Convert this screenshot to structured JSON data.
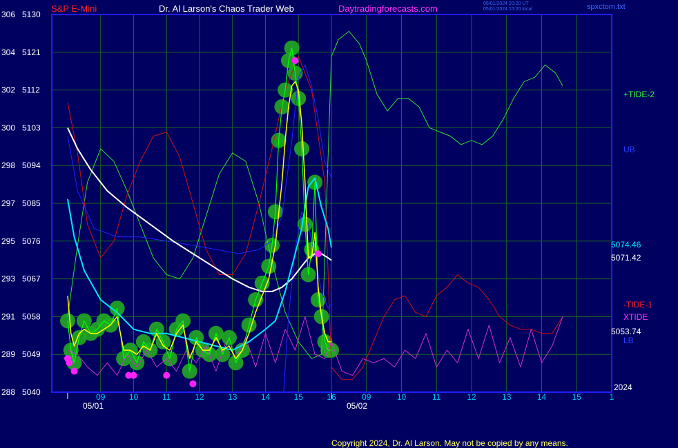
{
  "header": {
    "symbol": "S&P E-Mini",
    "title": "Dr. Al Larson's Chaos Trader Web",
    "site": "Daytradingforecasts.com",
    "stamp_ut": "05/01/2024 20:20 UT",
    "stamp_local": "05/01/2024 15:20 local",
    "file": "spxctom.txt"
  },
  "footer": {
    "copyright": "Copyright 2024, Dr. Al Larson. May not be copied by any means."
  },
  "labels": {
    "tide2": "+TIDE-2",
    "ub": "UB",
    "cyan_value": "5074.46",
    "white_value": "5071.42",
    "tide1": "-TIDE-1",
    "xtide": "XTIDE",
    "yellow_value": "5053.74",
    "lb": "LB",
    "year": "2024"
  },
  "colors": {
    "background": "#000060",
    "frame": "#1e1eff",
    "grid": "#1a6a1a",
    "price": "#00ff00",
    "smooth": "#ffff00",
    "cyan": "#00e5ff",
    "white": "#ffffff",
    "tide2": "#33dd33",
    "tide1": "#cc1111",
    "xtide": "#cc33cc",
    "bands": "#2222ff",
    "halo": "#22aa22",
    "marker": "#ff22ff"
  },
  "chart_data": {
    "type": "line",
    "y_left_labels": [
      "306",
      "304",
      "302",
      "300",
      "298",
      "297",
      "295",
      "293",
      "291",
      "289",
      "288"
    ],
    "y_right_labels": [
      "5130",
      "5121",
      "5112",
      "5103",
      "5094",
      "5085",
      "5076",
      "5067",
      "5058",
      "5049",
      "5040"
    ],
    "x_labels": [
      "09",
      "10",
      "11",
      "12",
      "13",
      "14",
      "15",
      "16",
      "09",
      "10",
      "11",
      "12",
      "13",
      "14",
      "15",
      "1"
    ],
    "date_labels": [
      "05/01",
      "05/02"
    ],
    "ylim": [
      5040,
      5130
    ],
    "grid": true,
    "series": [
      {
        "role": "price",
        "x": [
          8.0,
          8.1,
          8.2,
          8.35,
          8.5,
          8.7,
          8.9,
          9.1,
          9.3,
          9.5,
          9.7,
          9.9,
          10.1,
          10.3,
          10.5,
          10.7,
          10.9,
          11.1,
          11.3,
          11.5,
          11.7,
          11.9,
          12.1,
          12.3,
          12.5,
          12.7,
          12.9,
          13.1,
          13.3,
          13.5,
          13.7,
          13.9,
          14.1,
          14.2,
          14.3,
          14.4,
          14.5,
          14.6,
          14.7,
          14.8,
          14.9,
          15.0,
          15.1,
          15.2,
          15.3,
          15.4,
          15.5,
          15.6,
          15.7,
          15.8,
          15.9,
          16.0
        ],
        "values": [
          5057,
          5050,
          5047,
          5053,
          5057,
          5054,
          5055,
          5057,
          5056,
          5060,
          5048,
          5050,
          5047,
          5052,
          5050,
          5055,
          5052,
          5048,
          5055,
          5057,
          5045,
          5053,
          5050,
          5049,
          5054,
          5049,
          5053,
          5047,
          5050,
          5056,
          5062,
          5066,
          5070,
          5075,
          5083,
          5100,
          5108,
          5112,
          5119,
          5122,
          5116,
          5110,
          5098,
          5080,
          5068,
          5074,
          5090,
          5062,
          5058,
          5052,
          5050,
          5050
        ]
      },
      {
        "role": "smooth",
        "x": [
          8.0,
          8.1,
          8.2,
          8.35,
          8.5,
          8.7,
          8.9,
          9.1,
          9.3,
          9.5,
          9.7,
          9.9,
          10.1,
          10.3,
          10.5,
          10.7,
          10.9,
          11.1,
          11.3,
          11.5,
          11.7,
          11.9,
          12.1,
          12.3,
          12.5,
          12.7,
          12.9,
          13.1,
          13.3,
          13.5,
          13.7,
          13.9,
          14.1,
          14.3,
          14.5,
          14.6,
          14.7,
          14.8,
          14.9,
          15.0,
          15.1,
          15.2,
          15.3,
          15.4,
          15.5,
          15.6,
          15.7,
          15.8,
          15.9,
          16.0
        ],
        "values": [
          5063,
          5054,
          5051,
          5054,
          5055,
          5054,
          5054,
          5055,
          5056,
          5058,
          5050,
          5050,
          5049,
          5051,
          5050,
          5054,
          5051,
          5050,
          5054,
          5056,
          5048,
          5052,
          5050,
          5050,
          5053,
          5050,
          5051,
          5048,
          5050,
          5054,
          5059,
          5063,
          5067,
          5075,
          5090,
          5100,
          5108,
          5113,
          5114,
          5112,
          5104,
          5090,
          5072,
          5072,
          5078,
          5065,
          5058,
          5054,
          5052,
          5052
        ]
      },
      {
        "role": "cyan",
        "x": [
          8.0,
          8.2,
          8.5,
          9.0,
          9.5,
          10.0,
          10.5,
          11.0,
          11.5,
          12.0,
          12.5,
          13.0,
          13.5,
          14.0,
          14.3,
          14.6,
          14.9,
          15.1,
          15.3,
          15.5,
          15.7,
          15.9,
          16.0
        ],
        "values": [
          5086,
          5077,
          5069,
          5062,
          5059,
          5055,
          5054,
          5054,
          5053,
          5052,
          5051,
          5050,
          5052,
          5055,
          5057,
          5064,
          5073,
          5079,
          5089,
          5091,
          5084,
          5079,
          5074.46
        ]
      },
      {
        "role": "white",
        "x": [
          8.0,
          8.3,
          8.7,
          9.2,
          9.8,
          10.5,
          11.2,
          11.8,
          12.4,
          13.0,
          13.5,
          13.9,
          14.2,
          14.5,
          14.8,
          15.1,
          15.3,
          15.5,
          15.7,
          15.9,
          16.0
        ],
        "values": [
          5103,
          5098,
          5093,
          5088,
          5084,
          5080,
          5076,
          5073,
          5070,
          5067,
          5065,
          5064,
          5064,
          5065,
          5067,
          5070,
          5072,
          5073,
          5073,
          5072,
          5071.42
        ]
      },
      {
        "role": "tide2",
        "x": [
          8.0,
          8.3,
          8.6,
          9.0,
          9.4,
          9.8,
          10.2,
          10.6,
          11.0,
          11.4,
          11.8,
          12.2,
          12.6,
          13.0,
          13.4,
          13.8,
          14.2,
          14.6,
          15.0,
          15.4,
          15.7,
          16.0,
          16.2,
          16.5,
          16.8,
          17.0,
          17.3,
          17.6,
          17.9,
          18.2,
          18.5,
          18.8,
          19.1,
          19.4,
          19.7,
          20.0,
          20.3,
          20.6,
          20.9,
          21.2,
          21.5,
          21.8,
          22.1,
          22.4,
          22.6
        ],
        "values": [
          5058,
          5075,
          5090,
          5098,
          5095,
          5088,
          5080,
          5072,
          5068,
          5067,
          5072,
          5082,
          5092,
          5097,
          5095,
          5085,
          5071,
          5059,
          5052,
          5048,
          5049,
          5120,
          5124,
          5126,
          5123,
          5119,
          5111,
          5107,
          5110,
          5110,
          5108,
          5103,
          5102,
          5101,
          5099,
          5100,
          5099,
          5101,
          5105,
          5110,
          5114,
          5115,
          5118,
          5116,
          5113
        ]
      },
      {
        "role": "tide1",
        "x": [
          8.0,
          8.3,
          8.6,
          9.0,
          9.4,
          9.8,
          10.2,
          10.6,
          11.0,
          11.4,
          11.8,
          12.2,
          12.6,
          13.0,
          13.4,
          13.8,
          14.2,
          14.6,
          15.0,
          15.4,
          15.8,
          16.0,
          16.3,
          16.6,
          16.9,
          17.2,
          17.5,
          17.8,
          18.1,
          18.4,
          18.7,
          19.0,
          19.3,
          19.6,
          19.9,
          20.2,
          20.5,
          20.8,
          21.1,
          21.4,
          21.7,
          22.0,
          22.3,
          22.6
        ],
        "values": [
          5109,
          5097,
          5080,
          5072,
          5076,
          5087,
          5095,
          5101,
          5102,
          5096,
          5085,
          5074,
          5068,
          5068,
          5073,
          5085,
          5098,
          5112,
          5120,
          5112,
          5090,
          5046,
          5043,
          5043,
          5046,
          5052,
          5058,
          5062,
          5063,
          5059,
          5058,
          5063,
          5065,
          5068,
          5066,
          5065,
          5062,
          5058,
          5056,
          5055,
          5055,
          5054,
          5054,
          5058
        ]
      },
      {
        "role": "xtide",
        "x": [
          8.0,
          8.3,
          8.6,
          8.9,
          9.2,
          9.5,
          9.8,
          10.1,
          10.4,
          10.7,
          11.0,
          11.3,
          11.6,
          11.9,
          12.2,
          12.5,
          12.8,
          13.1,
          13.4,
          13.7,
          14.0,
          14.3,
          14.6,
          14.9,
          15.2,
          15.5,
          15.8,
          16.0,
          16.3,
          16.6,
          16.9,
          17.2,
          17.5,
          17.8,
          18.1,
          18.4,
          18.7,
          19.0,
          19.3,
          19.6,
          19.9,
          20.2,
          20.5,
          20.8,
          21.1,
          21.4,
          21.7,
          22.0,
          22.3,
          22.6
        ],
        "values": [
          5050,
          5049,
          5046,
          5044,
          5047,
          5044,
          5049,
          5046,
          5050,
          5046,
          5048,
          5045,
          5050,
          5047,
          5051,
          5045,
          5052,
          5048,
          5053,
          5046,
          5054,
          5047,
          5055,
          5050,
          5058,
          5049,
          5048,
          5052,
          5045,
          5044,
          5048,
          5047,
          5048,
          5046,
          5050,
          5048,
          5054,
          5046,
          5050,
          5047,
          5055,
          5048,
          5056,
          5047,
          5053,
          5046,
          5055,
          5047,
          5051,
          5058
        ]
      },
      {
        "role": "upper-band",
        "x": [
          8.0,
          8.3,
          8.8,
          9.5,
          10.2,
          11.0,
          11.8,
          12.5,
          13.2,
          13.8,
          14.2,
          14.5,
          14.8,
          15.0,
          15.2,
          15.4,
          15.6,
          15.8,
          16.0
        ],
        "values": [
          5101,
          5088,
          5079,
          5077,
          5077,
          5076,
          5075,
          5074,
          5073,
          5074,
          5076,
          5082,
          5100,
          5115,
          5118,
          5113,
          5105,
          5095,
          5091
        ]
      },
      {
        "role": "lower-band",
        "x": [
          14.55,
          14.7,
          14.9,
          15.1,
          15.3,
          15.5,
          15.7,
          15.9,
          16.0
        ],
        "values": [
          5040,
          5058,
          5074,
          5083,
          5080,
          5072,
          5064,
          5060,
          5061
        ]
      }
    ],
    "markers": [
      {
        "x": 8.0,
        "y": 5048
      },
      {
        "x": 8.05,
        "y": 5047
      },
      {
        "x": 8.2,
        "y": 5045
      },
      {
        "x": 9.85,
        "y": 5044
      },
      {
        "x": 10.0,
        "y": 5044
      },
      {
        "x": 11.0,
        "y": 5044
      },
      {
        "x": 11.8,
        "y": 5042
      },
      {
        "x": 14.9,
        "y": 5119
      },
      {
        "x": 15.6,
        "y": 5073
      }
    ]
  }
}
